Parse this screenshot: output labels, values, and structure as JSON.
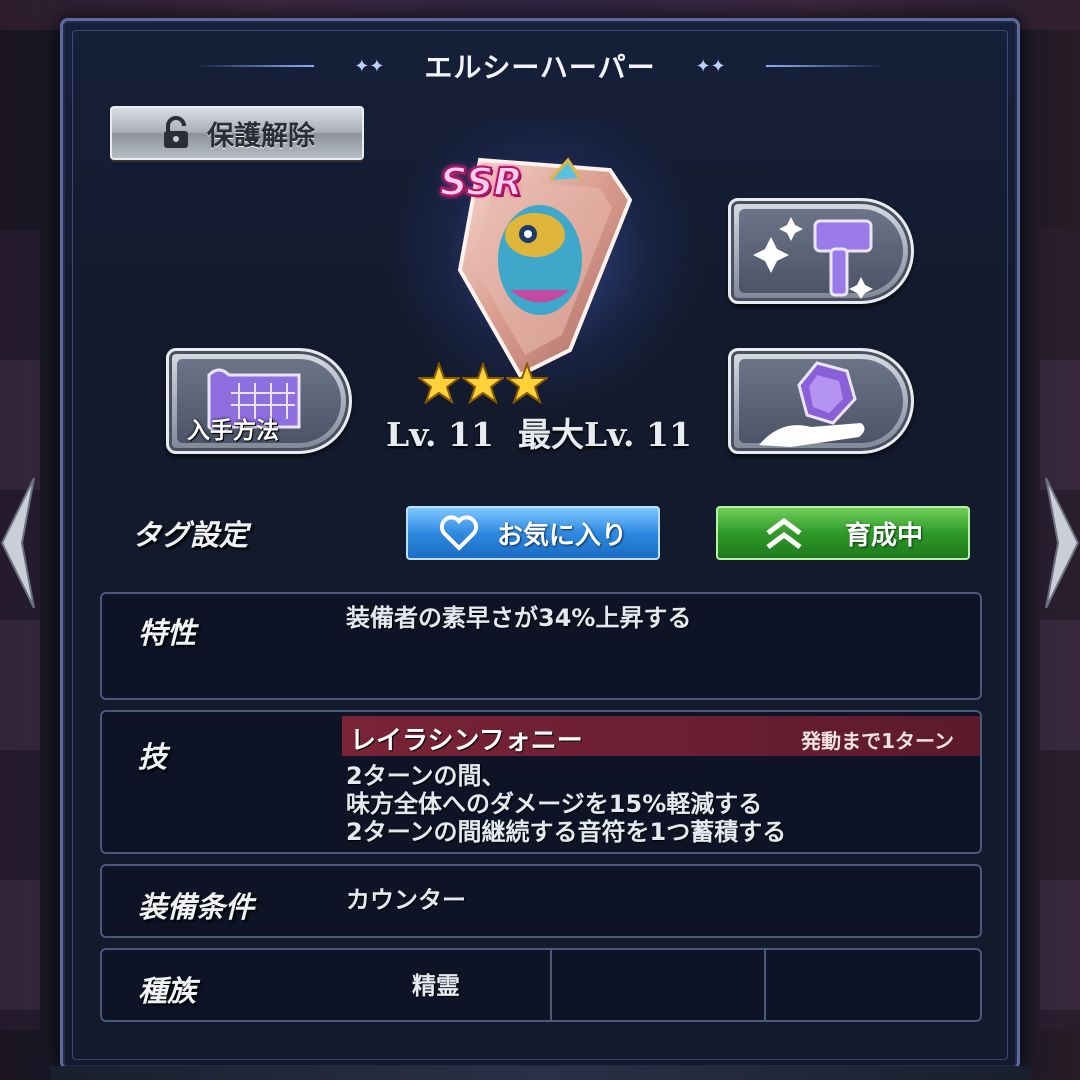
{
  "title": "エルシーハーパー",
  "protect_button": {
    "label": "保護解除",
    "icon": "unlock-icon"
  },
  "item": {
    "rarity": "SSR",
    "stars": 3,
    "level": "Lv. 11",
    "max_level": "最大Lv. 11"
  },
  "actions": {
    "acquire_label": "入手方法",
    "acquire_icon": "map-scroll-icon",
    "forge_icon": "hammer-sparkle-icon",
    "gem_icon": "gem-hand-icon"
  },
  "tags": {
    "label": "タグ設定",
    "favorite_label": "お気に入り",
    "training_label": "育成中"
  },
  "info": {
    "trait_label": "特性",
    "trait_text": "装備者の素早さが34%上昇する",
    "skill_label": "技",
    "skill_name": "レイラシンフォニー",
    "skill_turn": "発動まで1ターン",
    "skill_desc_1": "2ターンの間、",
    "skill_desc_2": "味方全体へのダメージを15%軽減する",
    "skill_desc_3": "2ターンの間継続する音符を1つ蓄積する",
    "condition_label": "装備条件",
    "condition_text": "カウンター",
    "race_label": "種族",
    "race_text": "精霊"
  },
  "colors": {
    "panel_border": "#5a6c9c",
    "favorite": "#2f8ae0",
    "training": "#2f9a2a",
    "skill_header": "#7a2338",
    "ssr": "#ff4aa8"
  }
}
